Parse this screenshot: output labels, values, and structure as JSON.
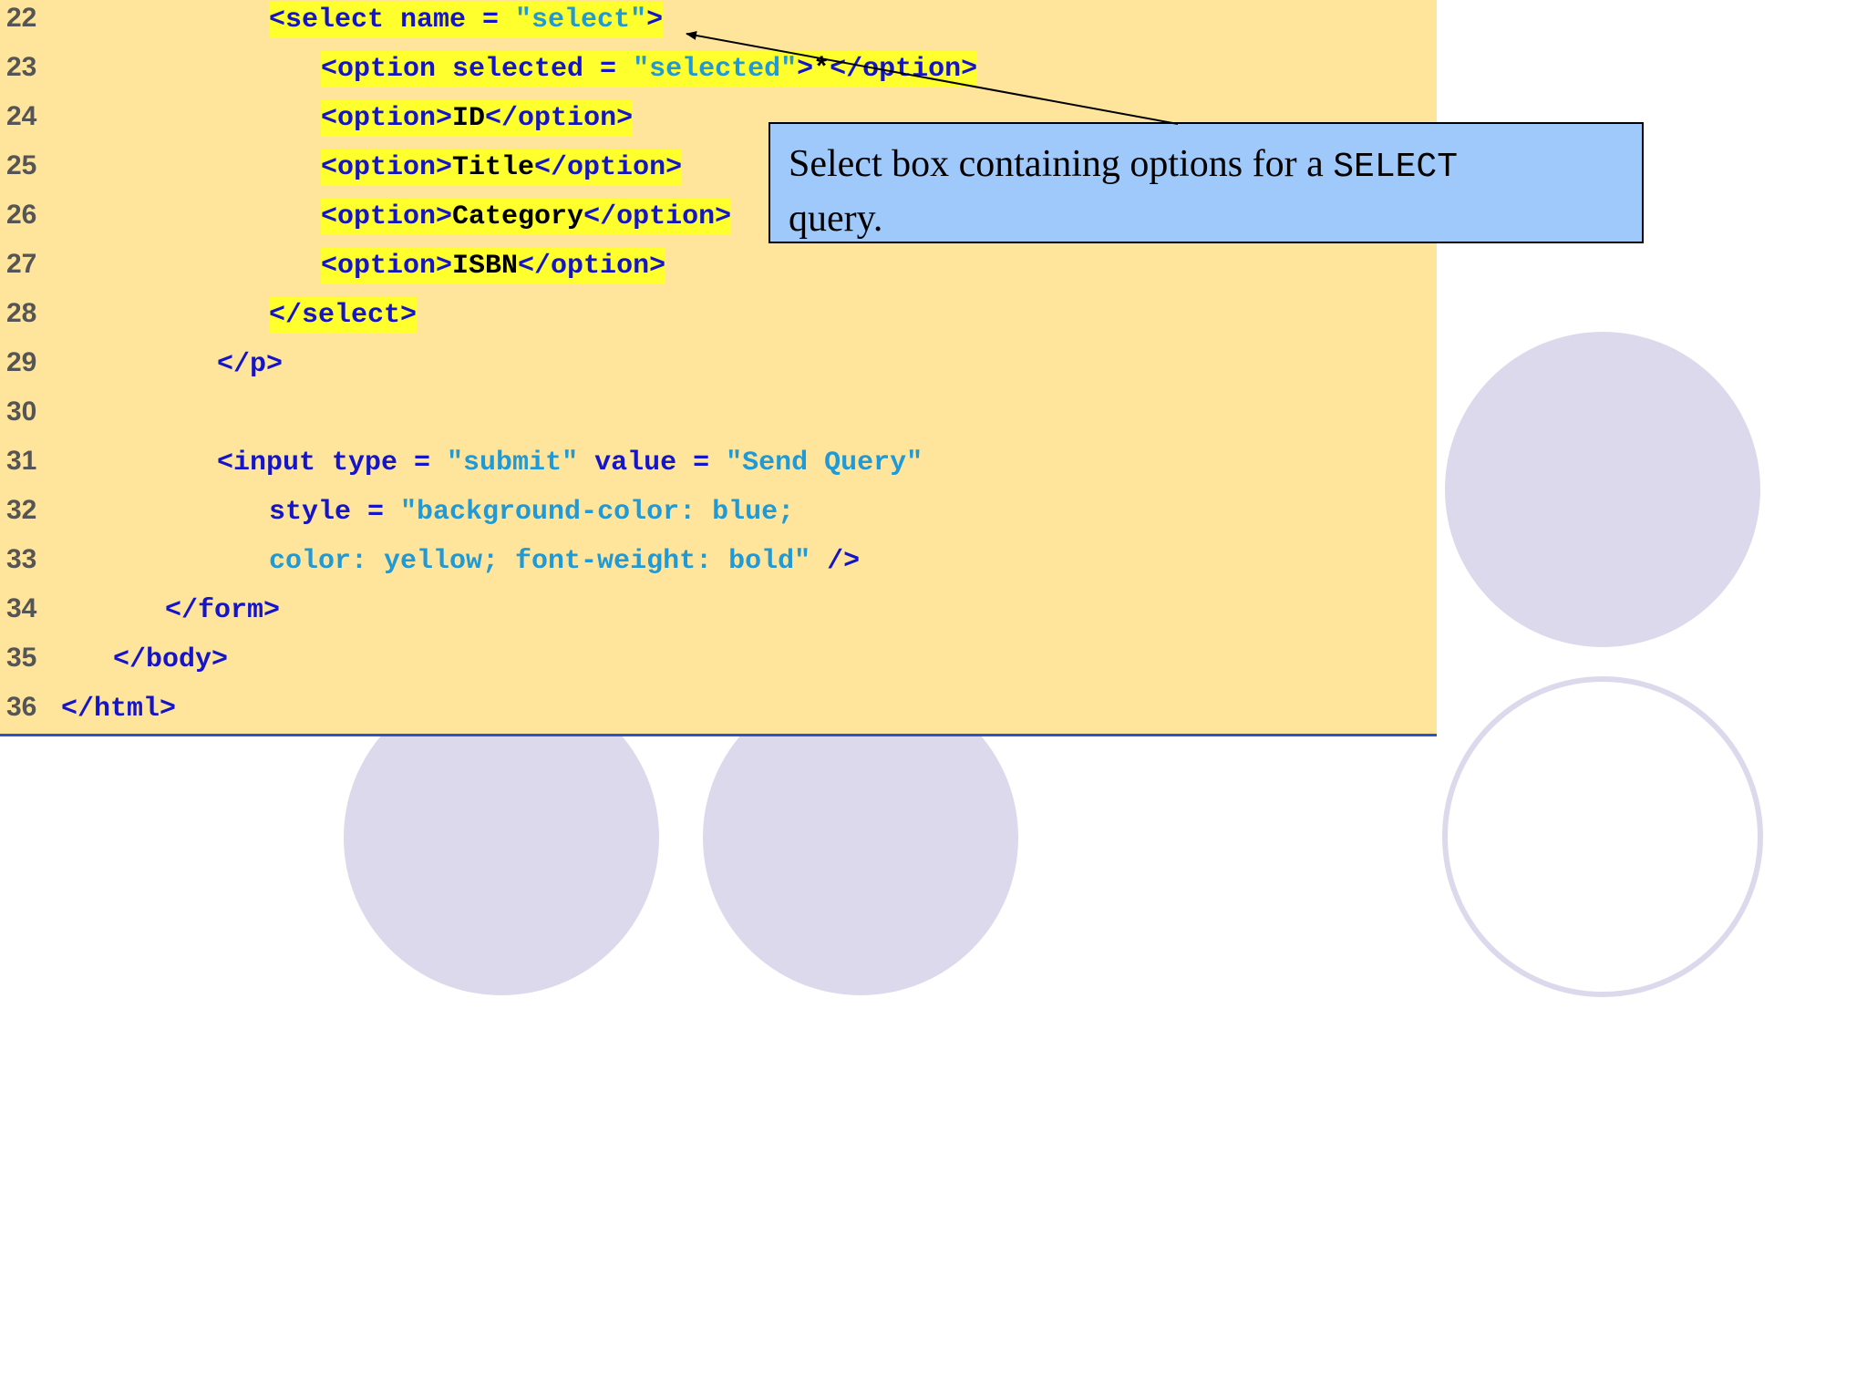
{
  "colors": {
    "panel_bg": "#ffe59b",
    "highlight": "#ffff2e",
    "tag_blue": "#1414c8",
    "string_cyan": "#1f9ad6",
    "callout_bg": "#9fc9fb",
    "decor_lavender": "#dcd9ec",
    "rule_blue": "#2a55c8"
  },
  "code_lines": [
    {
      "num": "22",
      "indent": 4,
      "highlight": true,
      "segments": [
        {
          "t": "<select name = ",
          "c": "tag"
        },
        {
          "t": "\"select\"",
          "c": "str"
        },
        {
          "t": ">",
          "c": "tag"
        }
      ]
    },
    {
      "num": "23",
      "indent": 5,
      "highlight": true,
      "segments": [
        {
          "t": "<option selected = ",
          "c": "tag"
        },
        {
          "t": "\"selected\"",
          "c": "str"
        },
        {
          "t": ">",
          "c": "tag"
        },
        {
          "t": "*",
          "c": "txt"
        },
        {
          "t": "</option>",
          "c": "tag"
        }
      ]
    },
    {
      "num": "24",
      "indent": 5,
      "highlight": true,
      "segments": [
        {
          "t": "<option>",
          "c": "tag"
        },
        {
          "t": "ID",
          "c": "txt"
        },
        {
          "t": "</option>",
          "c": "tag"
        }
      ]
    },
    {
      "num": "25",
      "indent": 5,
      "highlight": true,
      "segments": [
        {
          "t": "<option>",
          "c": "tag"
        },
        {
          "t": "Title",
          "c": "txt"
        },
        {
          "t": "</option>",
          "c": "tag"
        }
      ]
    },
    {
      "num": "26",
      "indent": 5,
      "highlight": true,
      "segments": [
        {
          "t": "<option>",
          "c": "tag"
        },
        {
          "t": "Category",
          "c": "txt"
        },
        {
          "t": "</option>",
          "c": "tag"
        }
      ]
    },
    {
      "num": "27",
      "indent": 5,
      "highlight": true,
      "segments": [
        {
          "t": "<option>",
          "c": "tag"
        },
        {
          "t": "ISBN",
          "c": "txt"
        },
        {
          "t": "</option>",
          "c": "tag"
        }
      ]
    },
    {
      "num": "28",
      "indent": 4,
      "highlight": true,
      "segments": [
        {
          "t": "</select>",
          "c": "tag"
        }
      ]
    },
    {
      "num": "29",
      "indent": 3,
      "highlight": false,
      "segments": [
        {
          "t": "</p>",
          "c": "tag"
        }
      ]
    },
    {
      "num": "30",
      "indent": 0,
      "highlight": false,
      "segments": []
    },
    {
      "num": "31",
      "indent": 3,
      "highlight": false,
      "segments": [
        {
          "t": "<input type = ",
          "c": "tag"
        },
        {
          "t": "\"submit\"",
          "c": "str"
        },
        {
          "t": " value = ",
          "c": "tag"
        },
        {
          "t": "\"Send Query\"",
          "c": "str"
        }
      ]
    },
    {
      "num": "32",
      "indent": 4,
      "highlight": false,
      "segments": [
        {
          "t": "style = ",
          "c": "tag"
        },
        {
          "t": "\"background-color: blue;",
          "c": "str"
        }
      ]
    },
    {
      "num": "33",
      "indent": 4,
      "highlight": false,
      "segments": [
        {
          "t": "color: yellow; font-weight: bold\"",
          "c": "str"
        },
        {
          "t": " />",
          "c": "tag"
        }
      ]
    },
    {
      "num": "34",
      "indent": 2,
      "highlight": false,
      "segments": [
        {
          "t": "</form>",
          "c": "tag"
        }
      ]
    },
    {
      "num": "35",
      "indent": 1,
      "highlight": false,
      "segments": [
        {
          "t": "</body>",
          "c": "tag"
        }
      ]
    },
    {
      "num": "36",
      "indent": 0,
      "highlight": false,
      "segments": [
        {
          "t": "</html>",
          "c": "tag"
        }
      ]
    }
  ],
  "callout": {
    "text_before": "Select box containing options for a ",
    "code_word": "SELECT",
    "text_after": "query."
  }
}
